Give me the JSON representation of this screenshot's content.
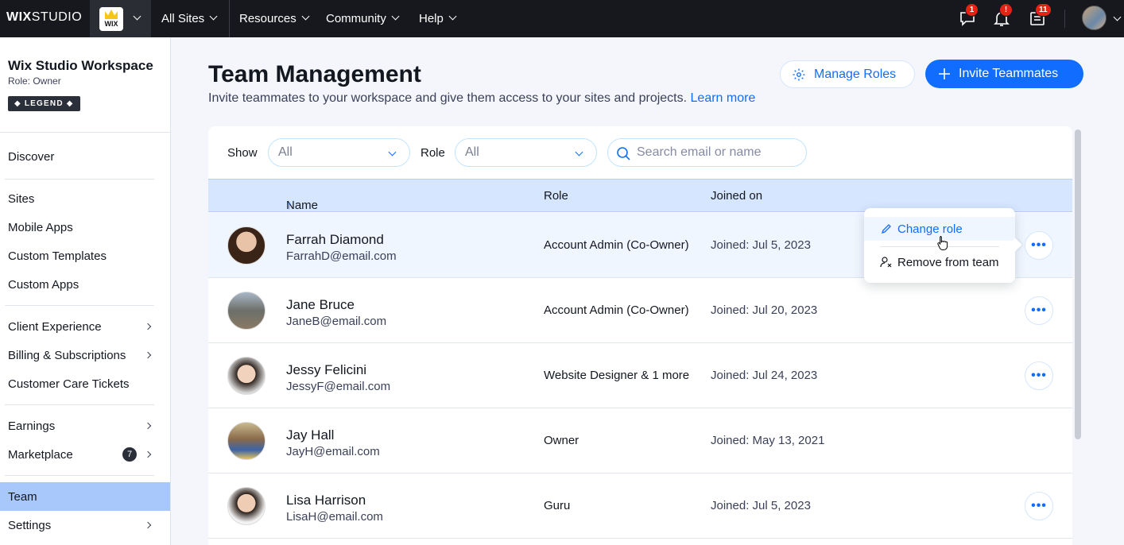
{
  "topbar": {
    "logo_bold": "WIX",
    "logo_light": "STUDIO",
    "site_thumb_label": "WIX",
    "nav": [
      "All Sites",
      "Resources",
      "Community",
      "Help"
    ],
    "badges": {
      "chat": "1",
      "notifications": "!",
      "inbox": "11"
    }
  },
  "sidebar": {
    "workspace_title": "Wix Studio Workspace",
    "workspace_role": "Role: Owner",
    "legend_badge": "◆ LEGEND ◆",
    "items": [
      {
        "label": "Discover"
      },
      {
        "label": "Sites"
      },
      {
        "label": "Mobile Apps"
      },
      {
        "label": "Custom Templates"
      },
      {
        "label": "Custom Apps"
      },
      {
        "label": "Client Experience"
      },
      {
        "label": "Billing & Subscriptions"
      },
      {
        "label": "Customer Care Tickets"
      },
      {
        "label": "Earnings"
      },
      {
        "label": "Marketplace",
        "count": "7"
      },
      {
        "label": "Team"
      },
      {
        "label": "Settings"
      }
    ]
  },
  "main": {
    "title": "Team Management",
    "subtitle": "Invite teammates to your workspace and give them access to your sites and projects.",
    "learn_more": "Learn more",
    "manage_roles": "Manage Roles",
    "invite": "Invite Teammates"
  },
  "filters": {
    "show_label": "Show",
    "show_value": "All",
    "role_label": "Role",
    "role_value": "All",
    "search_placeholder": "Search email or name"
  },
  "table": {
    "columns": {
      "name": "Name",
      "role": "Role",
      "joined": "Joined on"
    },
    "sort_indicator": "↑",
    "rows": [
      {
        "name": "Farrah Diamond",
        "email": "FarrahD@email.com",
        "role": "Account Admin (Co-Owner)",
        "joined": "Joined: Jul 5, 2023"
      },
      {
        "name": "Jane Bruce",
        "email": "JaneB@email.com",
        "role": "Account Admin (Co-Owner)",
        "joined": "Joined: Jul 20, 2023"
      },
      {
        "name": "Jessy Felicini",
        "email": "JessyF@email.com",
        "role": "Website Designer & 1 more",
        "joined": "Joined: Jul 24, 2023"
      },
      {
        "name": "Jay Hall",
        "email": "JayH@email.com",
        "role": "Owner",
        "joined": "Joined: May 13, 2021"
      },
      {
        "name": "Lisa Harrison",
        "email": "LisaH@email.com",
        "role": "Guru",
        "joined": "Joined: Jul 5, 2023"
      }
    ],
    "more_glyph": "•••"
  },
  "row_menu": {
    "change_role": "Change role",
    "remove": "Remove from team"
  },
  "colors": {
    "accent": "#116dff",
    "topbar": "#16181d",
    "active_nav": "#a8c8fb",
    "badge": "#e62214"
  }
}
